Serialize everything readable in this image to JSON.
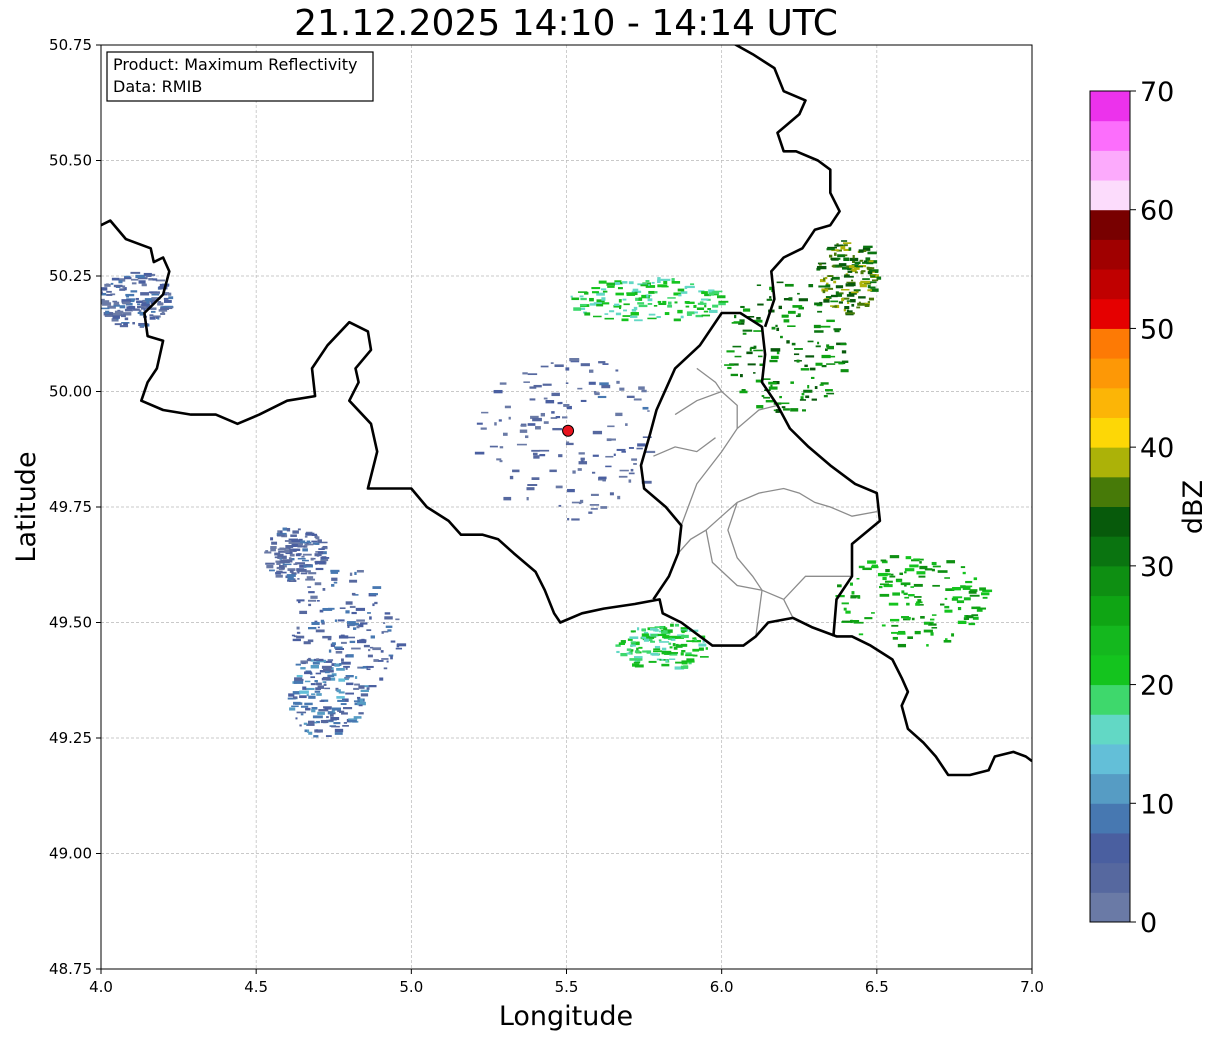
{
  "title": "21.12.2025 14:10 - 14:14 UTC",
  "info_box": {
    "product_line": "Product: Maximum Reflectivity",
    "data_line": "Data: RMIB"
  },
  "axes": {
    "xlabel": "Longitude",
    "ylabel": "Latitude",
    "xlim": [
      4.0,
      7.0
    ],
    "ylim": [
      48.75,
      50.75
    ],
    "xticks": [
      "4.0",
      "4.5",
      "5.0",
      "5.5",
      "6.0",
      "6.5",
      "7.0"
    ],
    "yticks": [
      "48.75",
      "49.00",
      "49.25",
      "49.50",
      "49.75",
      "50.00",
      "50.25",
      "50.50",
      "50.75"
    ],
    "grid": true
  },
  "radar_site": {
    "lon": 5.505,
    "lat": 49.915,
    "color": "#e8141e"
  },
  "colorbar": {
    "label": "dBZ",
    "min": 0,
    "max": 70,
    "step": 2.5,
    "tick_labels": [
      "0",
      "10",
      "20",
      "30",
      "40",
      "50",
      "60",
      "70"
    ],
    "colors": [
      "#6a7aa6",
      "#56689f",
      "#4a5fa0",
      "#4778b1",
      "#569cc4",
      "#63bfd8",
      "#62d8c5",
      "#3ed86c",
      "#14c41e",
      "#14b81e",
      "#0fa514",
      "#0e8f12",
      "#0a7410",
      "#075a0b",
      "#477a08",
      "#acb208",
      "#fdd706",
      "#fcb506",
      "#fd9806",
      "#fd7a05",
      "#e50000",
      "#c00000",
      "#a00000",
      "#780000",
      "#fcdcfc",
      "#fcaafc",
      "#fc6efc",
      "#ec32ec"
    ]
  },
  "chart_data": {
    "type": "heatmap",
    "title": "21.12.2025 14:10 - 14:14 UTC",
    "xlabel": "Longitude",
    "ylabel": "Latitude",
    "xlim": [
      4.0,
      7.0
    ],
    "ylim": [
      48.75,
      50.75
    ],
    "value_label": "dBZ",
    "value_range": [
      0,
      70
    ],
    "precipitation_areas": [
      {
        "lon": 4.72,
        "lat": 49.34,
        "dlon": 0.12,
        "dlat": 0.09,
        "dbz": 8
      },
      {
        "lon": 4.78,
        "lat": 49.48,
        "dlon": 0.18,
        "dlat": 0.14,
        "dbz": 5
      },
      {
        "lon": 4.62,
        "lat": 49.65,
        "dlon": 0.1,
        "dlat": 0.06,
        "dbz": 4
      },
      {
        "lon": 4.1,
        "lat": 50.2,
        "dlon": 0.12,
        "dlat": 0.06,
        "dbz": 4
      },
      {
        "lon": 5.5,
        "lat": 49.9,
        "dlon": 0.3,
        "dlat": 0.18,
        "dbz": 3
      },
      {
        "lon": 5.75,
        "lat": 50.2,
        "dlon": 0.25,
        "dlat": 0.05,
        "dbz": 20
      },
      {
        "lon": 6.2,
        "lat": 50.1,
        "dlon": 0.2,
        "dlat": 0.15,
        "dbz": 30
      },
      {
        "lon": 6.4,
        "lat": 50.25,
        "dlon": 0.1,
        "dlat": 0.08,
        "dbz": 35
      },
      {
        "lon": 6.6,
        "lat": 49.55,
        "dlon": 0.25,
        "dlat": 0.1,
        "dbz": 25
      },
      {
        "lon": 5.8,
        "lat": 49.45,
        "dlon": 0.15,
        "dlat": 0.05,
        "dbz": 20
      }
    ]
  },
  "borders": {
    "national": [
      [
        [
          4.0,
          50.36
        ],
        [
          4.03,
          50.37
        ],
        [
          4.08,
          50.33
        ],
        [
          4.12,
          50.32
        ],
        [
          4.16,
          50.31
        ],
        [
          4.17,
          50.28
        ],
        [
          4.2,
          50.29
        ],
        [
          4.22,
          50.26
        ],
        [
          4.2,
          50.21
        ],
        [
          4.14,
          50.17
        ],
        [
          4.15,
          50.12
        ],
        [
          4.2,
          50.11
        ],
        [
          4.18,
          50.05
        ],
        [
          4.15,
          50.02
        ],
        [
          4.13,
          49.98
        ],
        [
          4.2,
          49.96
        ],
        [
          4.29,
          49.95
        ],
        [
          4.37,
          49.95
        ],
        [
          4.44,
          49.93
        ],
        [
          4.51,
          49.95
        ],
        [
          4.6,
          49.98
        ],
        [
          4.69,
          49.99
        ],
        [
          4.68,
          50.05
        ],
        [
          4.73,
          50.1
        ],
        [
          4.8,
          50.15
        ],
        [
          4.86,
          50.13
        ],
        [
          4.87,
          50.09
        ],
        [
          4.82,
          50.05
        ],
        [
          4.83,
          50.02
        ],
        [
          4.8,
          49.98
        ],
        [
          4.87,
          49.93
        ],
        [
          4.89,
          49.87
        ],
        [
          4.86,
          49.79
        ],
        [
          4.93,
          49.79
        ],
        [
          5.0,
          49.79
        ],
        [
          5.05,
          49.75
        ],
        [
          5.12,
          49.72
        ],
        [
          5.16,
          49.69
        ],
        [
          5.23,
          49.69
        ],
        [
          5.28,
          49.68
        ],
        [
          5.33,
          49.65
        ],
        [
          5.4,
          49.61
        ],
        [
          5.43,
          49.57
        ],
        [
          5.46,
          49.52
        ],
        [
          5.48,
          49.5
        ],
        [
          5.55,
          49.52
        ],
        [
          5.62,
          49.53
        ],
        [
          5.72,
          49.54
        ],
        [
          5.8,
          49.55
        ],
        [
          5.81,
          49.52
        ],
        [
          5.87,
          49.5
        ],
        [
          5.97,
          49.45
        ],
        [
          6.07,
          49.45
        ],
        [
          6.11,
          49.47
        ],
        [
          6.15,
          49.5
        ],
        [
          6.23,
          49.51
        ],
        [
          6.29,
          49.49
        ],
        [
          6.37,
          49.47
        ],
        [
          6.42,
          49.47
        ],
        [
          6.48,
          49.45
        ],
        [
          6.55,
          49.42
        ],
        [
          6.58,
          49.38
        ],
        [
          6.6,
          49.35
        ],
        [
          6.58,
          49.32
        ],
        [
          6.6,
          49.27
        ],
        [
          6.65,
          49.24
        ],
        [
          6.69,
          49.21
        ],
        [
          6.73,
          49.17
        ],
        [
          6.8,
          49.17
        ],
        [
          6.86,
          49.18
        ],
        [
          6.88,
          49.21
        ],
        [
          6.94,
          49.22
        ],
        [
          6.98,
          49.21
        ],
        [
          7.0,
          49.2
        ]
      ],
      [
        [
          5.78,
          49.55
        ],
        [
          5.83,
          49.6
        ],
        [
          5.86,
          49.65
        ],
        [
          5.87,
          49.71
        ],
        [
          5.82,
          49.75
        ],
        [
          5.75,
          49.79
        ],
        [
          5.74,
          49.84
        ],
        [
          5.77,
          49.91
        ],
        [
          5.79,
          49.96
        ],
        [
          5.85,
          50.05
        ],
        [
          5.93,
          50.1
        ],
        [
          6.0,
          50.17
        ],
        [
          6.06,
          50.17
        ],
        [
          6.13,
          50.14
        ],
        [
          6.14,
          50.08
        ],
        [
          6.13,
          50.02
        ],
        [
          6.18,
          49.97
        ],
        [
          6.22,
          49.92
        ],
        [
          6.28,
          49.88
        ],
        [
          6.35,
          49.84
        ],
        [
          6.43,
          49.8
        ],
        [
          6.5,
          49.78
        ],
        [
          6.51,
          49.72
        ],
        [
          6.42,
          49.67
        ],
        [
          6.42,
          49.6
        ],
        [
          6.37,
          49.55
        ],
        [
          6.36,
          49.47
        ]
      ],
      [
        [
          6.14,
          50.14
        ],
        [
          6.17,
          50.2
        ],
        [
          6.16,
          50.26
        ],
        [
          6.2,
          50.29
        ],
        [
          6.26,
          50.31
        ],
        [
          6.3,
          50.35
        ],
        [
          6.35,
          50.36
        ],
        [
          6.38,
          50.39
        ],
        [
          6.35,
          50.43
        ],
        [
          6.35,
          50.48
        ],
        [
          6.31,
          50.5
        ],
        [
          6.24,
          50.52
        ],
        [
          6.2,
          50.52
        ],
        [
          6.18,
          50.56
        ],
        [
          6.25,
          50.6
        ],
        [
          6.27,
          50.63
        ],
        [
          6.2,
          50.65
        ],
        [
          6.17,
          50.7
        ],
        [
          6.1,
          50.73
        ],
        [
          6.02,
          50.76
        ]
      ]
    ],
    "regional": [
      [
        [
          5.86,
          49.65
        ],
        [
          5.9,
          49.68
        ],
        [
          5.95,
          49.7
        ],
        [
          6.0,
          49.73
        ],
        [
          6.05,
          49.76
        ],
        [
          6.12,
          49.78
        ],
        [
          6.2,
          49.79
        ],
        [
          6.25,
          49.78
        ],
        [
          6.3,
          49.76
        ],
        [
          6.35,
          49.75
        ],
        [
          6.42,
          49.73
        ],
        [
          6.5,
          49.74
        ]
      ],
      [
        [
          5.95,
          49.7
        ],
        [
          5.97,
          49.63
        ],
        [
          6.05,
          49.58
        ],
        [
          6.13,
          49.57
        ],
        [
          6.2,
          49.55
        ],
        [
          6.27,
          49.6
        ],
        [
          6.35,
          49.6
        ],
        [
          6.42,
          49.6
        ]
      ],
      [
        [
          6.05,
          49.76
        ],
        [
          6.02,
          49.7
        ],
        [
          6.05,
          49.64
        ],
        [
          6.1,
          49.6
        ],
        [
          6.13,
          49.57
        ]
      ],
      [
        [
          6.2,
          49.55
        ],
        [
          6.23,
          49.51
        ]
      ],
      [
        [
          6.13,
          49.57
        ],
        [
          6.12,
          49.52
        ],
        [
          6.11,
          49.47
        ]
      ],
      [
        [
          5.87,
          49.71
        ],
        [
          5.92,
          49.8
        ],
        [
          6.0,
          49.87
        ],
        [
          6.05,
          49.92
        ],
        [
          6.12,
          49.96
        ],
        [
          6.18,
          49.97
        ]
      ],
      [
        [
          5.78,
          49.86
        ],
        [
          5.85,
          49.88
        ],
        [
          5.92,
          49.87
        ],
        [
          5.98,
          49.9
        ]
      ],
      [
        [
          5.85,
          49.95
        ],
        [
          5.92,
          49.98
        ],
        [
          6.0,
          50.0
        ],
        [
          6.05,
          49.97
        ],
        [
          6.05,
          49.92
        ]
      ],
      [
        [
          5.92,
          50.05
        ],
        [
          5.98,
          50.02
        ],
        [
          6.0,
          50.0
        ]
      ]
    ]
  }
}
